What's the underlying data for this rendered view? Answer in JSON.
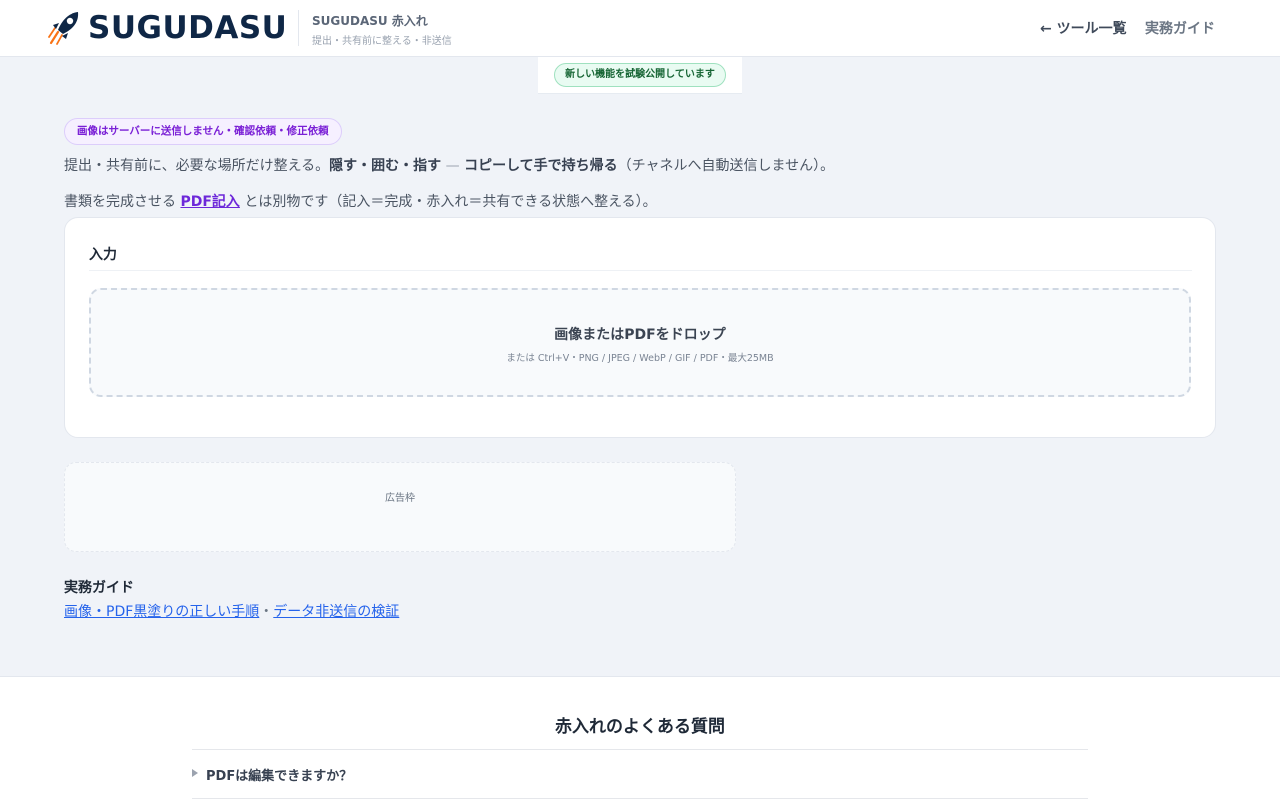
{
  "header": {
    "brand": "SUGUDASU",
    "tool_name": "SUGUDASU 赤入れ",
    "tool_desc": "提出・共有前に整える・非送信",
    "nav_tools": "← ツール一覧",
    "nav_guide": "実務ガイド"
  },
  "notice": "新しい機能を試験公開しています",
  "intro": {
    "badge": "画像はサーバーに送信しません・確認依頼・修正依頼",
    "lead_prefix": "提出・共有前に、必要な場所だけ整える。",
    "lead_bold1": "隠す・囲む・指す",
    "lead_dash": " — ",
    "lead_bold2": "コピーして手で持ち帰る",
    "lead_suffix": "（チャネルへ自動送信しません）。",
    "line2_prefix": "書類を完成させる ",
    "line2_link": "PDF記入",
    "line2_suffix": " とは別物です（記入＝完成・赤入れ＝共有できる状態へ整える）。"
  },
  "input_card": {
    "title": "入力",
    "drop_main": "画像またはPDFをドロップ",
    "drop_sub": "または Ctrl+V・PNG / JPEG / WebP / GIF / PDF・最大25MB"
  },
  "ad": {
    "label": "広告枠"
  },
  "guide": {
    "title": "実務ガイド",
    "link1": "画像・PDF黒塗りの正しい手順",
    "sep": "・",
    "link2": "データ非送信の検証"
  },
  "faq": {
    "title": "赤入れのよくある質問",
    "items": [
      {
        "question": "PDFは編集できますか？"
      }
    ]
  },
  "colors": {
    "brand_navy": "#0f2746",
    "accent_purple": "#7a1fd6",
    "notice_green": "#166534",
    "link_blue": "#2563eb",
    "rocket_orange": "#f97316"
  },
  "icons": {
    "logo": "rocket-icon",
    "faq_toggle": "triangle-right-icon"
  }
}
